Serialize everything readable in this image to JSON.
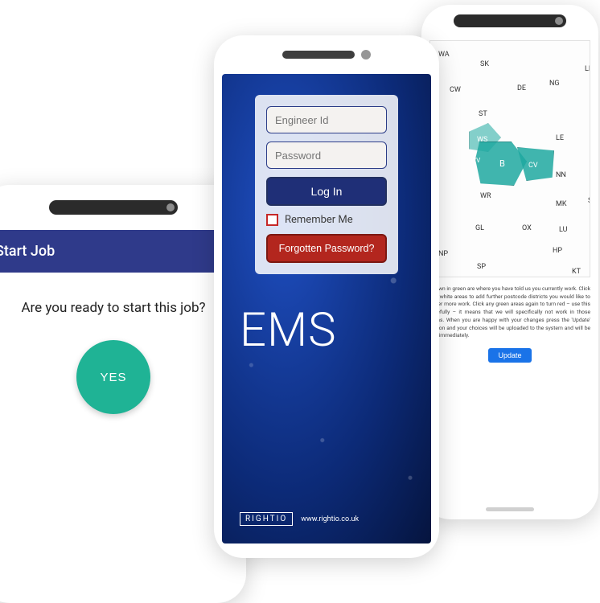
{
  "start": {
    "header": "Start Job",
    "question": "Are you ready to start this job?",
    "yes": "YES"
  },
  "login": {
    "engineer_placeholder": "Engineer Id",
    "password_placeholder": "Password",
    "login_label": "Log In",
    "remember_label": "Remember Me",
    "forgot_label": "Forgotten Password?",
    "app_title": "EMS",
    "brand": "RIGHTIO",
    "brand_url": "www.rightio.co.uk"
  },
  "map": {
    "regions": [
      "WA",
      "SK",
      "DE",
      "NG",
      "LN",
      "CW",
      "ST",
      "WS",
      "B",
      "CV",
      "LE",
      "NN",
      "WV",
      "WR",
      "GL",
      "OX",
      "MK",
      "SG",
      "LU",
      "HP",
      "SP",
      "NP",
      "KT"
    ],
    "paragraph": "shown in green are where you have told us you currently work. Click any white areas to add further postcode districts you would like to cover more work. Click any green areas again to turn red – use this carefully – it means that we will specifically not work in those areas. When you are happy with your changes press the 'Update' button and your choices will be uploaded to the system and will be live immediately.",
    "update_label": "Update"
  }
}
